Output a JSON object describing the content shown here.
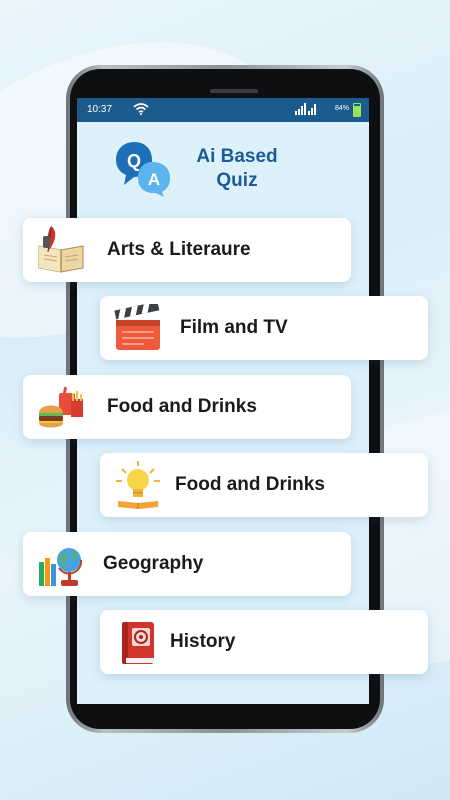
{
  "status_bar": {
    "time": "10:37",
    "battery": "84%"
  },
  "app": {
    "title_line1": "Ai Based",
    "title_line2": "Quiz",
    "logo_letters": [
      "Q",
      "A"
    ]
  },
  "categories": [
    {
      "label": "Arts & Literaure",
      "icon": "book-quill-icon"
    },
    {
      "label": "Film and TV",
      "icon": "clapperboard-icon"
    },
    {
      "label": "Food and Drinks",
      "icon": "burger-fries-icon"
    },
    {
      "label": "Food and Drinks",
      "icon": "lightbulb-book-icon"
    },
    {
      "label": "Geography",
      "icon": "globe-books-icon"
    },
    {
      "label": "History",
      "icon": "red-book-icon"
    }
  ],
  "colors": {
    "status_bar": "#1c5b8d",
    "title": "#1d5a9a",
    "screen_bg": "#ddf1fb"
  }
}
